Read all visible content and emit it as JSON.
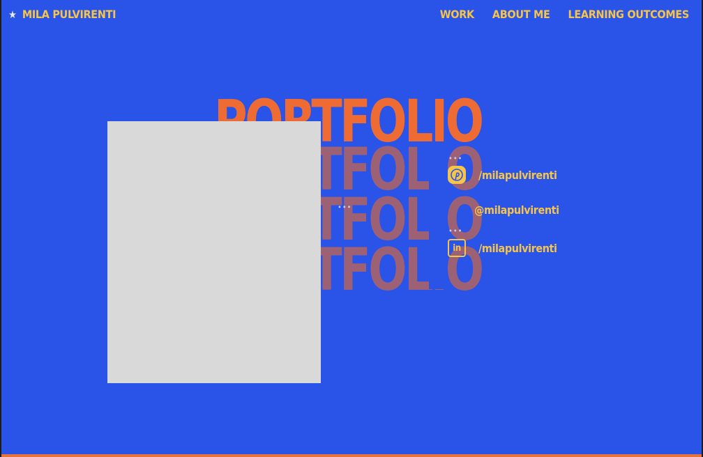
{
  "header": {
    "brand_icon": "star-icon",
    "brand_name": "MILA PULVIRENTI",
    "nav": [
      {
        "label": "WORK"
      },
      {
        "label": "ABOUT ME"
      },
      {
        "label": "LEARNING OUTCOMES"
      }
    ]
  },
  "hero": {
    "title": "PORTFOLIO",
    "echo": "PORTFOLIO"
  },
  "social": [
    {
      "icon": "pinterest-icon",
      "handle": "/milapulvirenti"
    },
    {
      "icon": "instagram-icon",
      "handle": "@milapulvirenti"
    },
    {
      "icon": "linkedin-icon",
      "handle": "/milapulvirenti"
    }
  ],
  "colors": {
    "background": "#2a53e8",
    "accent": "#f5c44a",
    "title": "#ee6c33",
    "title_echo": "#9d6176",
    "photo_placeholder": "#d9d9d9"
  }
}
